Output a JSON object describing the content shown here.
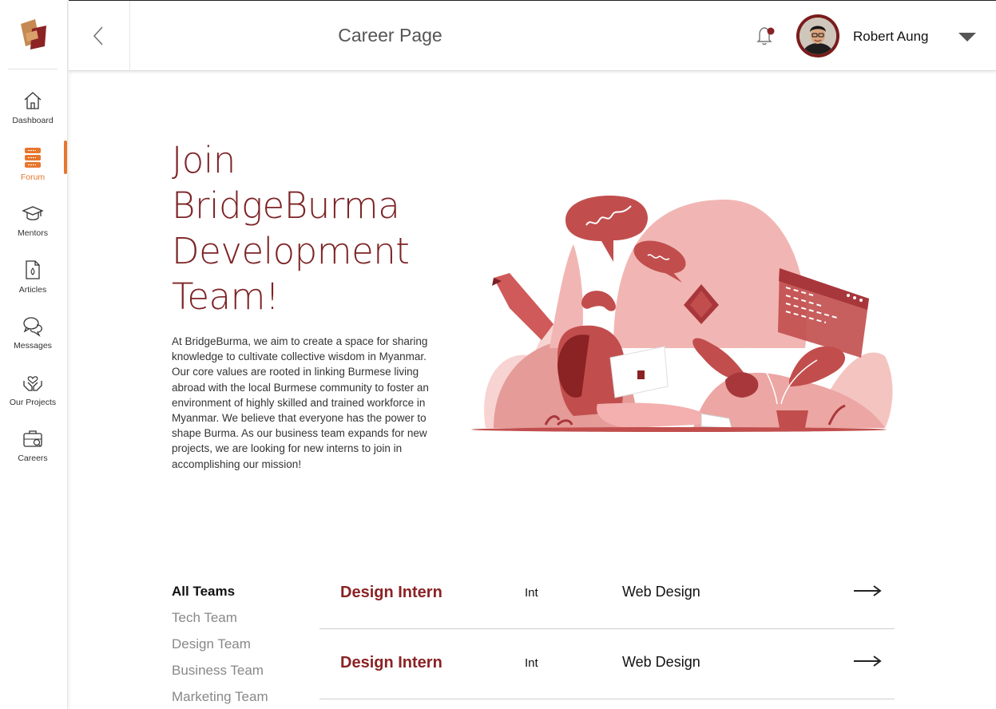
{
  "header": {
    "title": "Career Page",
    "user_name": "Robert Aung"
  },
  "sidebar": {
    "items": [
      {
        "label": "Dashboard",
        "icon": "home-icon"
      },
      {
        "label": "Forum",
        "icon": "forum-icon",
        "active": true
      },
      {
        "label": "Mentors",
        "icon": "graduation-cap-icon"
      },
      {
        "label": "Articles",
        "icon": "document-icon"
      },
      {
        "label": "Messages",
        "icon": "chat-bubbles-icon"
      },
      {
        "label": "Our Projects",
        "icon": "hands-heart-icon"
      },
      {
        "label": "Careers",
        "icon": "briefcase-icon"
      }
    ]
  },
  "hero": {
    "title": "Join BridgeBurma Development Team!",
    "body": "At BridgeBurma, we aim to create a space for sharing knowledge to cultivate collective wisdom in Myanmar. Our core values are rooted in linking Burmese living abroad with the local Burmese community to foster an environment of highly skilled and trained workforce in Myanmar. We believe that everyone has the power to shape Burma. As our business team expands for new projects, we are looking for new interns to join in accomplishing our mission!"
  },
  "teams": [
    "All Teams",
    "Tech Team",
    "Design Team",
    "Business Team",
    "Marketing Team"
  ],
  "jobs": [
    {
      "title": "Design Intern",
      "type": "Int",
      "category": "Web Design"
    },
    {
      "title": "Design Intern",
      "type": "Int",
      "category": "Web Design"
    }
  ],
  "colors": {
    "accent": "#e8762d",
    "brand": "#7d2325",
    "job_title": "#8b2224"
  }
}
